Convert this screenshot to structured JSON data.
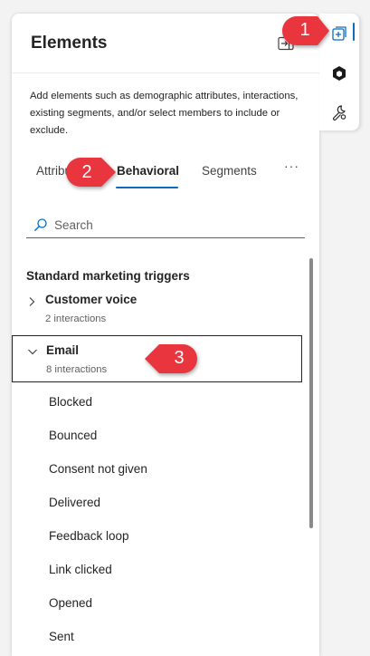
{
  "panel": {
    "title": "Elements",
    "description": "Add elements such as demographic attributes, interactions, existing segments, and/or select members to include or exclude."
  },
  "tabs": [
    {
      "label": "Attributes",
      "selected": false
    },
    {
      "label": "Behavioral",
      "selected": true
    },
    {
      "label": "Segments",
      "selected": false
    },
    {
      "label": "···",
      "selected": false
    }
  ],
  "search": {
    "placeholder": "Search",
    "value": ""
  },
  "section": {
    "heading": "Standard marketing triggers"
  },
  "groups": [
    {
      "label": "Customer voice",
      "count": "2 interactions",
      "expanded": false,
      "icon": "chevron-right-icon"
    },
    {
      "label": "Email",
      "count": "8 interactions",
      "expanded": true,
      "icon": "chevron-down-icon"
    }
  ],
  "email_items": [
    "Blocked",
    "Bounced",
    "Consent not given",
    "Delivered",
    "Feedback loop",
    "Link clicked",
    "Opened",
    "Sent"
  ],
  "side_rail": [
    {
      "icon": "add-elements-icon",
      "active": true
    },
    {
      "icon": "copilot-icon",
      "active": false
    },
    {
      "icon": "wrench-settings-icon",
      "active": false
    }
  ],
  "callouts": [
    "1",
    "2",
    "3"
  ],
  "colors": {
    "accent": "#0f6cbd",
    "callout": "#e8353e",
    "text": "#242424",
    "secondary_text": "#616161"
  }
}
